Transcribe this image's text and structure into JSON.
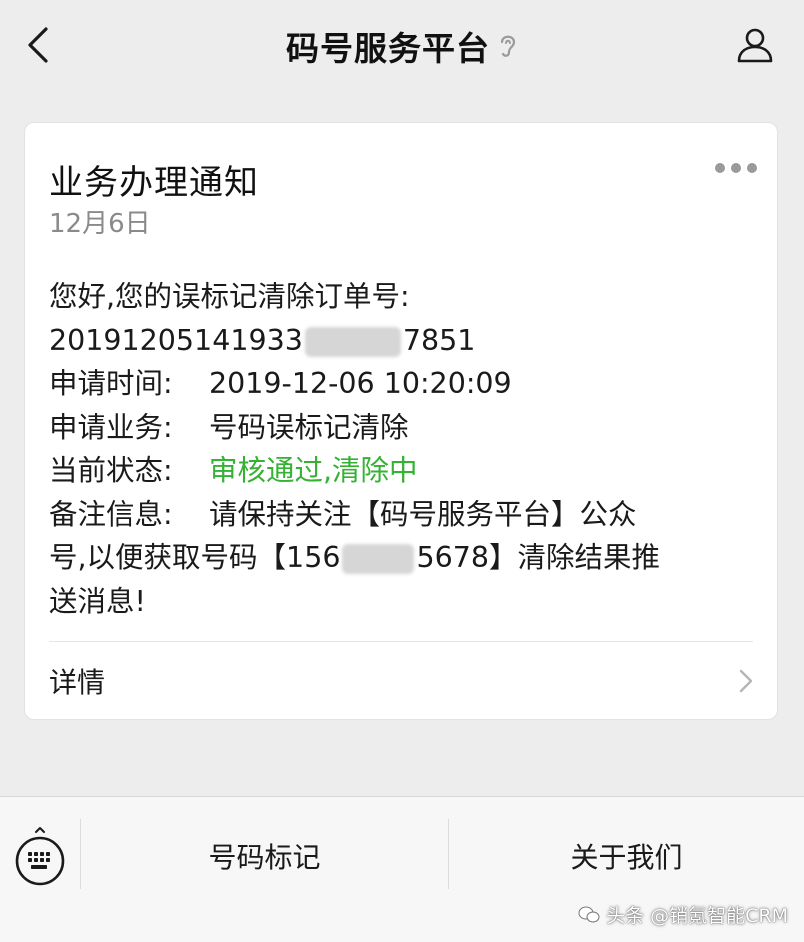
{
  "header": {
    "title": "码号服务平台",
    "back_icon": "chevron-left-icon",
    "ear_icon": "ear-icon",
    "profile_icon": "person-icon"
  },
  "card": {
    "title": "业务办理通知",
    "date": "12月6日",
    "greeting": "您好,您的误标记清除订单号:",
    "order_prefix": "20191205141933",
    "order_suffix": "7851",
    "fields": [
      {
        "label": "申请时间:",
        "value": "2019-12-06 10:20:09"
      },
      {
        "label": "申请业务:",
        "value": "号码误标记清除"
      },
      {
        "label": "当前状态:",
        "value": "审核通过,清除中"
      }
    ],
    "remark_label": "备注信息:",
    "remark_line1": "请保持关注【码号服务平台】公众",
    "remark_line2_prefix": "号,以便获取号码【156",
    "remark_line2_suffix": "5678】清除结果推",
    "remark_line3": "送消息!",
    "detail_label": "详情",
    "status_color": "#35b233"
  },
  "menu": {
    "items": [
      {
        "label": "号码标记"
      },
      {
        "label": "关于我们"
      }
    ],
    "keyboard_icon": "keyboard-icon"
  },
  "watermark": {
    "text": "头条 @销氪智能CRM"
  }
}
